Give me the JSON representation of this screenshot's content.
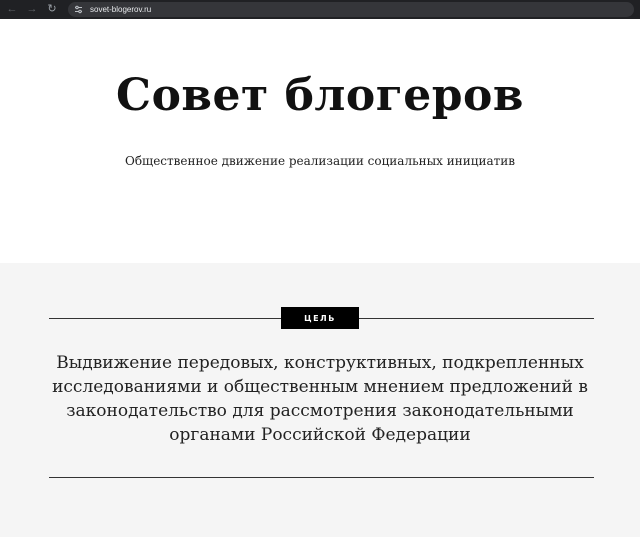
{
  "browser": {
    "back_icon": "arrow-left-icon",
    "forward_icon": "arrow-right-icon",
    "reload_icon": "reload-icon",
    "site_info_icon": "tune-icon",
    "url": "sovet-blogerov.ru"
  },
  "hero": {
    "title": "Совет блогеров",
    "subtitle": "Общественное движение реализации социальных инициатив"
  },
  "goal": {
    "badge": "ЦЕЛЬ",
    "text": "Выдвижение передовых, конструктивных, подкрепленных исследованиями и общественным мнением предложений в законодательство для рассмотрения законодательными органами Российской Федерации"
  },
  "colors": {
    "browser_bar": "#202124",
    "section_bg": "#f5f5f5",
    "badge_bg": "#000000"
  }
}
